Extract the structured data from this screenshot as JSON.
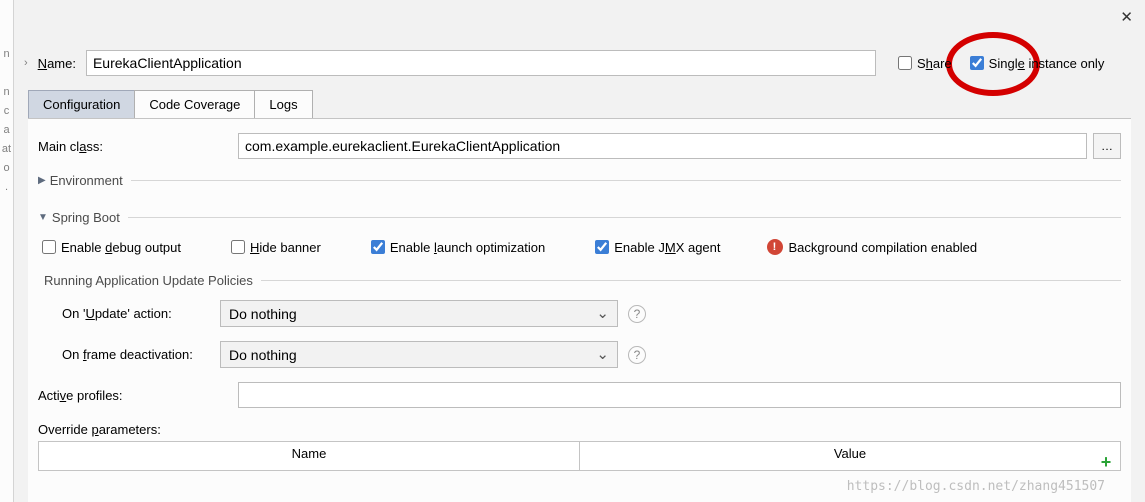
{
  "header": {
    "name_label": "Name:",
    "name_value": "EurekaClientApplication",
    "share_label": "Share",
    "single_instance_label": "Single instance only"
  },
  "left_sidebar_chars": [
    "n",
    "",
    "n",
    "c",
    "a",
    "at",
    "o",
    ""
  ],
  "tabs": {
    "configuration": "Configuration",
    "code_coverage": "Code Coverage",
    "logs": "Logs"
  },
  "config": {
    "main_class_label": "Main class:",
    "main_class_value": "com.example.eurekaclient.EurekaClientApplication",
    "environment_label": "Environment",
    "spring_boot_label": "Spring Boot",
    "enable_debug": "Enable debug output",
    "hide_banner": "Hide banner",
    "enable_launch_opt": "Enable launch optimization",
    "enable_jmx": "Enable JMX agent",
    "bg_compilation": "Background compilation enabled",
    "running_policies_title": "Running Application Update Policies",
    "on_update_label": "On 'Update' action:",
    "on_update_value": "Do nothing",
    "on_frame_label": "On frame deactivation:",
    "on_frame_value": "Do nothing",
    "active_profiles_label": "Active profiles:",
    "active_profiles_value": "",
    "override_params_label": "Override parameters:",
    "table_col_name": "Name",
    "table_col_value": "Value"
  },
  "watermark": "https://blog.csdn.net/zhang451507"
}
